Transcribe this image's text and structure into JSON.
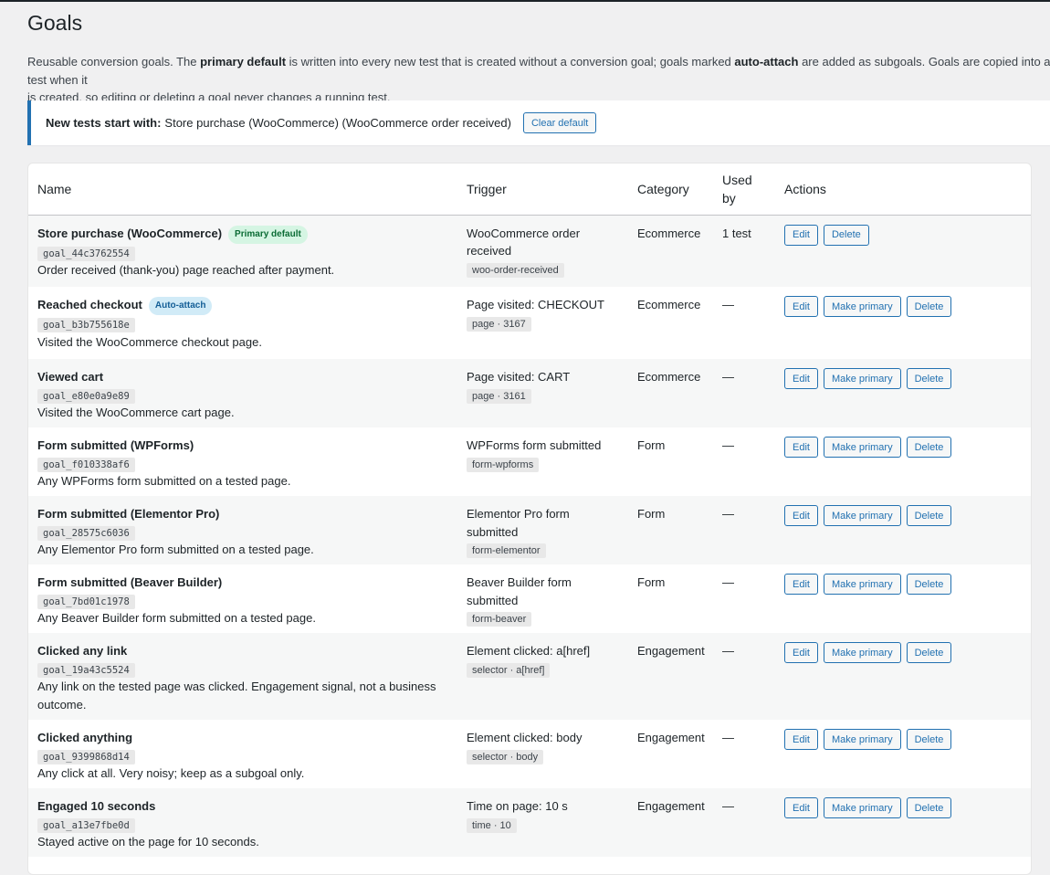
{
  "page": {
    "title": "Goals",
    "intro": {
      "p1": "Reusable conversion goals. The ",
      "b1": "primary default",
      "p2": " is written into every new test that is created without a conversion goal; goals marked ",
      "b2": "auto-attach",
      "p3": " are added as subgoals. Goals are copied into a test when it",
      "p4": "is created, so editing or deleting a goal never changes a running test."
    },
    "notice": {
      "label": "New tests start with:",
      "value": "Store purchase (WooCommerce) (WooCommerce order received)",
      "button": "Clear default"
    }
  },
  "table": {
    "headers": {
      "name": "Name",
      "trigger": "Trigger",
      "category": "Category",
      "used_by_1": "Used",
      "used_by_2": "by",
      "actions": "Actions"
    },
    "actions": {
      "edit": "Edit",
      "make_primary": "Make primary",
      "delete": "Delete"
    },
    "rows": [
      {
        "name": "Store purchase (WooCommerce)",
        "badge": "Primary default",
        "id": "goal_44c3762554",
        "desc": "Order received (thank-you) page reached after payment.",
        "trigger1": "WooCommerce order",
        "trigger2": "received",
        "trigger_code": "woo-order-received",
        "category": "Ecommerce",
        "used_by": "1 test"
      },
      {
        "name": "Reached checkout",
        "badge": "Auto-attach",
        "id": "goal_b3b755618e",
        "desc": "Visited the WooCommerce checkout page.",
        "trigger1": "Page visited: CHECKOUT",
        "trigger2": "",
        "trigger_code": "page · 3167",
        "category": "Ecommerce",
        "used_by": "—"
      },
      {
        "name": "Viewed cart",
        "badge": "",
        "id": "goal_e80e0a9e89",
        "desc": "Visited the WooCommerce cart page.",
        "trigger1": "Page visited: CART",
        "trigger2": "",
        "trigger_code": "page · 3161",
        "category": "Ecommerce",
        "used_by": "—"
      },
      {
        "name": "Form submitted (WPForms)",
        "badge": "",
        "id": "goal_f010338af6",
        "desc": "Any WPForms form submitted on a tested page.",
        "trigger1": "WPForms form submitted",
        "trigger2": "",
        "trigger_code": "form-wpforms",
        "category": "Form",
        "used_by": "—"
      },
      {
        "name": "Form submitted (Elementor Pro)",
        "badge": "",
        "id": "goal_28575c6036",
        "desc": "Any Elementor Pro form submitted on a tested page.",
        "trigger1": "Elementor Pro form",
        "trigger2": "submitted",
        "trigger_code": "form-elementor",
        "category": "Form",
        "used_by": "—"
      },
      {
        "name": "Form submitted (Beaver Builder)",
        "badge": "",
        "id": "goal_7bd01c1978",
        "desc": "Any Beaver Builder form submitted on a tested page.",
        "trigger1": "Beaver Builder form",
        "trigger2": "submitted",
        "trigger_code": "form-beaver",
        "category": "Form",
        "used_by": "—"
      },
      {
        "name": "Clicked any link",
        "badge": "",
        "id": "goal_19a43c5524",
        "desc": "Any link on the tested page was clicked. Engagement signal, not a business",
        "desc2": "outcome.",
        "trigger1": "Element clicked: a[href]",
        "trigger2": "",
        "trigger_code": "selector · a[href]",
        "category": "Engagement",
        "used_by": "—"
      },
      {
        "name": "Clicked anything",
        "badge": "",
        "id": "goal_9399868d14",
        "desc": "Any click at all. Very noisy; keep as a subgoal only.",
        "trigger1": "Element clicked: body",
        "trigger2": "",
        "trigger_code": "selector · body",
        "category": "Engagement",
        "used_by": "—"
      },
      {
        "name": "Engaged 10 seconds",
        "badge": "",
        "id": "goal_a13e7fbe0d",
        "desc": "Stayed active on the page for 10 seconds.",
        "trigger1": "Time on page: 10 s",
        "trigger2": "",
        "trigger_code": "time · 10",
        "category": "Engagement",
        "used_by": "—"
      }
    ]
  }
}
